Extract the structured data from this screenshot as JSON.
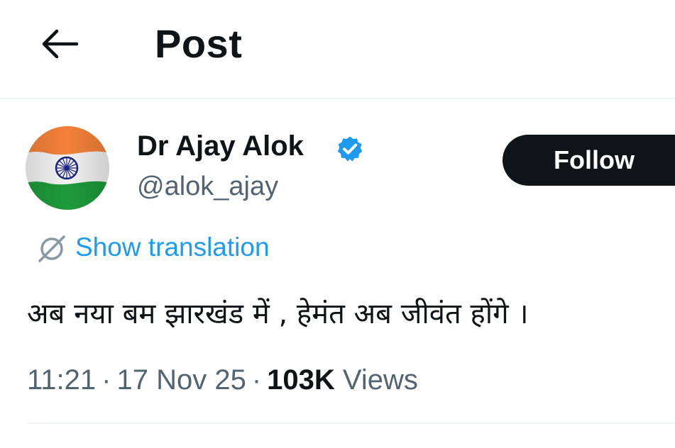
{
  "header": {
    "back_icon": "arrow-left-icon",
    "title": "Post"
  },
  "author": {
    "display_name": "Dr Ajay Alok",
    "verified_icon": "verified-badge-icon",
    "verified_color": "#1d9bf0",
    "handle": "@alok_ajay",
    "avatar_icon": "indian-flag-avatar"
  },
  "follow_button": {
    "label": "Follow"
  },
  "translation": {
    "icon": "globe-slash-icon",
    "label": "Show translation"
  },
  "post": {
    "text": "अब नया बम झारखंड में , हेमंत अब जीवंत होंगे ।",
    "time": "11:21",
    "date": "17 Nov 25",
    "separator": "·",
    "views_count": "103K",
    "views_label": "Views"
  },
  "colors": {
    "accent": "#1d9bf0",
    "text_primary": "#0f1419",
    "text_secondary": "#536471",
    "divider": "#eff3f4",
    "button_bg": "#0f1419"
  }
}
